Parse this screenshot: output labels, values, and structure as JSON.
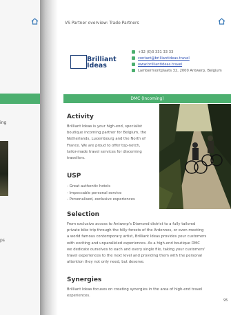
{
  "header": {
    "title": "VS Partner overview: Trade Partners"
  },
  "logo": {
    "name_line1": "Brilliant",
    "name_line2": "Ideas"
  },
  "contacts": [
    {
      "icon": "phone-icon",
      "text": "+32 (0)3 331 33 33",
      "link": false
    },
    {
      "icon": "mail-icon",
      "text": "contact@brilliantideas.travel",
      "link": true
    },
    {
      "icon": "globe-icon",
      "text": "www.brilliantideas.travel",
      "link": true
    },
    {
      "icon": "pin-icon",
      "text": "Lambermontplaats 32, 2000 Antwerp, Belgium",
      "link": false
    }
  ],
  "dmc_bar": "DMC (Incoming)",
  "activity": {
    "title": "Activity",
    "lines": [
      "Brilliant Ideas is your high-end, specialist",
      "boutique incoming partner for Belgium, the",
      "Netherlands, Luxembourg and the North of",
      "France. We are proud to offer top-notch,",
      "tailor-made travel services for discerning",
      "travellers."
    ]
  },
  "usp": {
    "title": "USP",
    "items": [
      "Great authentic hotels",
      "Impeccable personal service",
      "Personalised, exclusive experiences"
    ]
  },
  "selection": {
    "title": "Selection",
    "lines": [
      "From exclusive access to Antwerp's Diamond district to a fully tailored",
      "private bike trip through the hilly forests of the Ardennes, or even meeting",
      "a world famous contemporary artist, Brilliant Ideas provides your customers",
      "with exciting and unparalleled experiences. As a high-end boutique DMC",
      "we dedicate ourselves to each and every single file, taking your customers'",
      "travel experiences to the next level and providing them with the personal",
      "attention they not only need, but deserve."
    ]
  },
  "synergies": {
    "title": "Synergies",
    "lines": [
      "Brilliant Ideas focuses on creating synergies in the area of high-end travel",
      "experiences."
    ]
  },
  "page_number": "95",
  "left_page": {
    "snippet1": "ing",
    "snippet2": "ps"
  },
  "colors": {
    "accent_green": "#4caf6f",
    "brand_blue": "#1d3f78",
    "link_blue": "#2c4fb4"
  }
}
